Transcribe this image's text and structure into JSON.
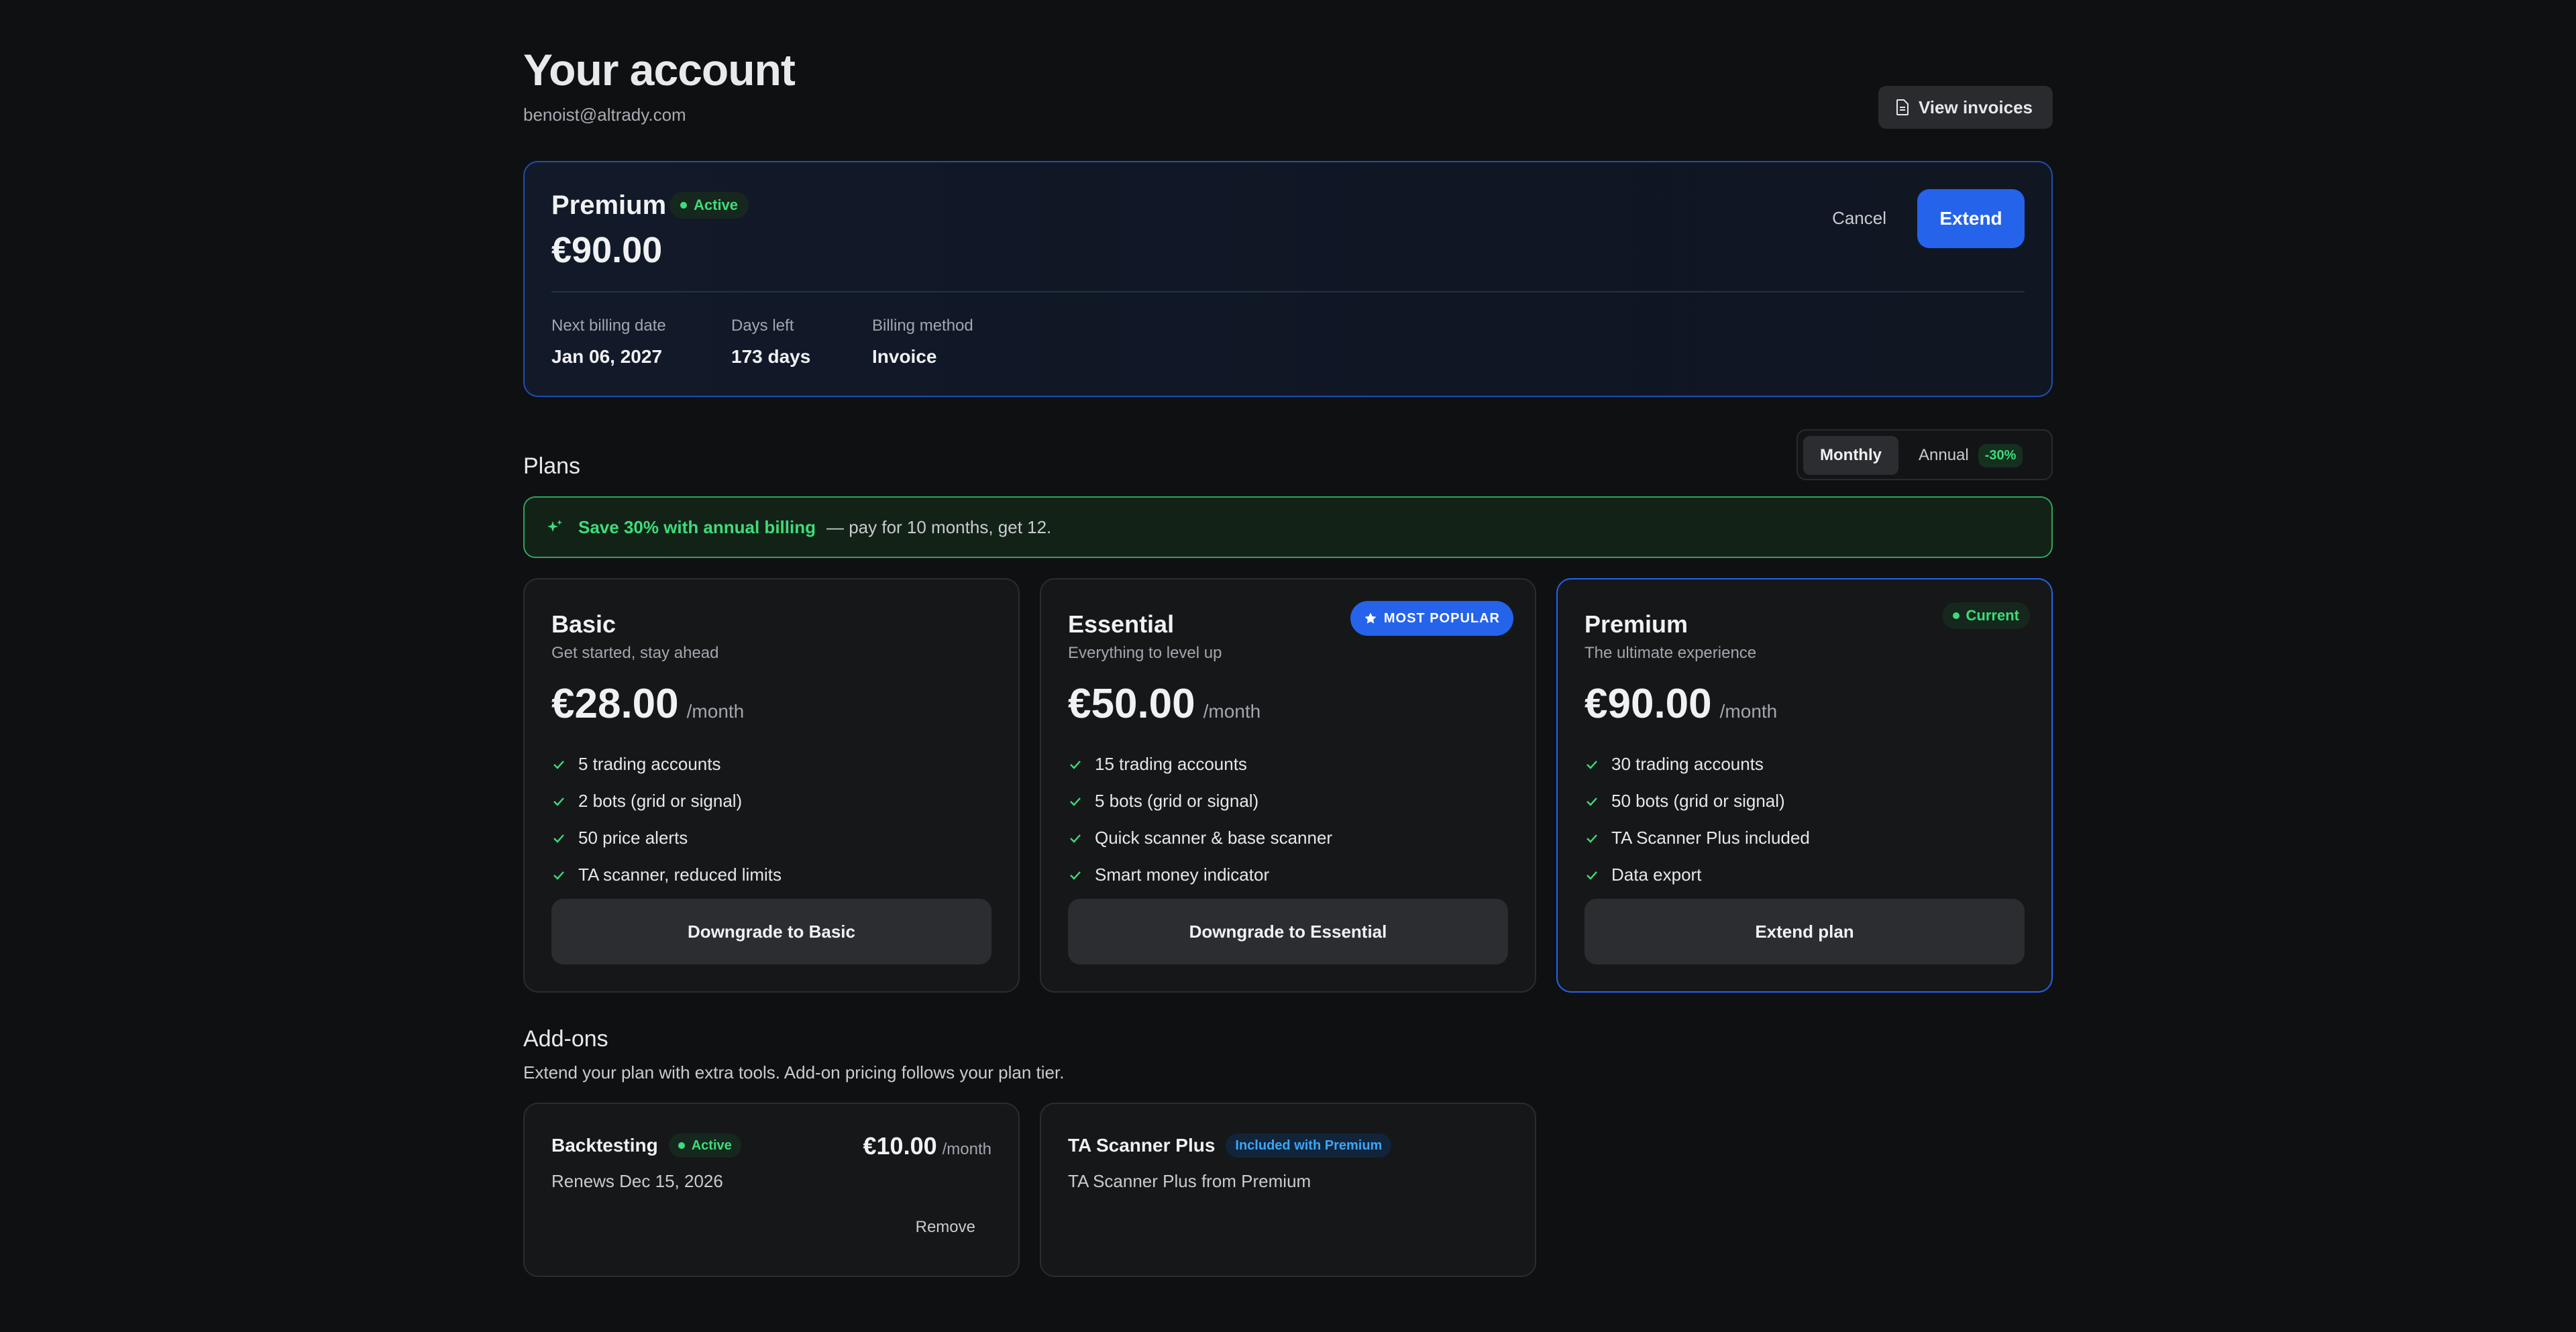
{
  "header": {
    "title": "Your account",
    "email": "benoist@altrady.com",
    "invoices_label": "View invoices"
  },
  "current_plan": {
    "name": "Premium",
    "status": "Active",
    "price": "€90.00",
    "cancel_label": "Cancel",
    "extend_label": "Extend",
    "stats": [
      {
        "label": "Next billing date",
        "value": "Jan 06, 2027"
      },
      {
        "label": "Days left",
        "value": "173 days"
      },
      {
        "label": "Billing method",
        "value": "Invoice"
      }
    ]
  },
  "plans": {
    "title": "Plans",
    "toggle": {
      "monthly": "Monthly",
      "annual": "Annual",
      "discount": "-30%"
    },
    "promo": {
      "strong": "Save 30% with annual billing",
      "rest": "— pay for 10 months, get 12."
    },
    "items": [
      {
        "name": "Basic",
        "tagline": "Get started, stay ahead",
        "price": "€28.00",
        "period": "/month",
        "features": [
          "5 trading accounts",
          "2 bots (grid or signal)",
          "50 price alerts",
          "TA scanner, reduced limits"
        ],
        "button": "Downgrade to Basic"
      },
      {
        "name": "Essential",
        "tagline": "Everything to level up",
        "price": "€50.00",
        "period": "/month",
        "badge": "MOST POPULAR",
        "features": [
          "15 trading accounts",
          "5 bots (grid or signal)",
          "Quick scanner & base scanner",
          "Smart money indicator"
        ],
        "button": "Downgrade to Essential"
      },
      {
        "name": "Premium",
        "tagline": "The ultimate experience",
        "price": "€90.00",
        "period": "/month",
        "badge": "Current",
        "features": [
          "30 trading accounts",
          "50 bots (grid or signal)",
          "TA Scanner Plus included",
          "Data export"
        ],
        "button": "Extend plan"
      }
    ]
  },
  "addons": {
    "title": "Add-ons",
    "subtitle": "Extend your plan with extra tools. Add-on pricing follows your plan tier.",
    "items": [
      {
        "name": "Backtesting",
        "status": "Active",
        "price": "€10.00",
        "period": "/month",
        "sub": "Renews Dec 15, 2026",
        "action": "Remove"
      },
      {
        "name": "TA Scanner Plus",
        "badge": "Included with Premium",
        "sub": "TA Scanner Plus from Premium"
      }
    ]
  },
  "colors": {
    "accent": "#2563eb",
    "success": "#3ddc7a",
    "background": "#0f1012"
  }
}
